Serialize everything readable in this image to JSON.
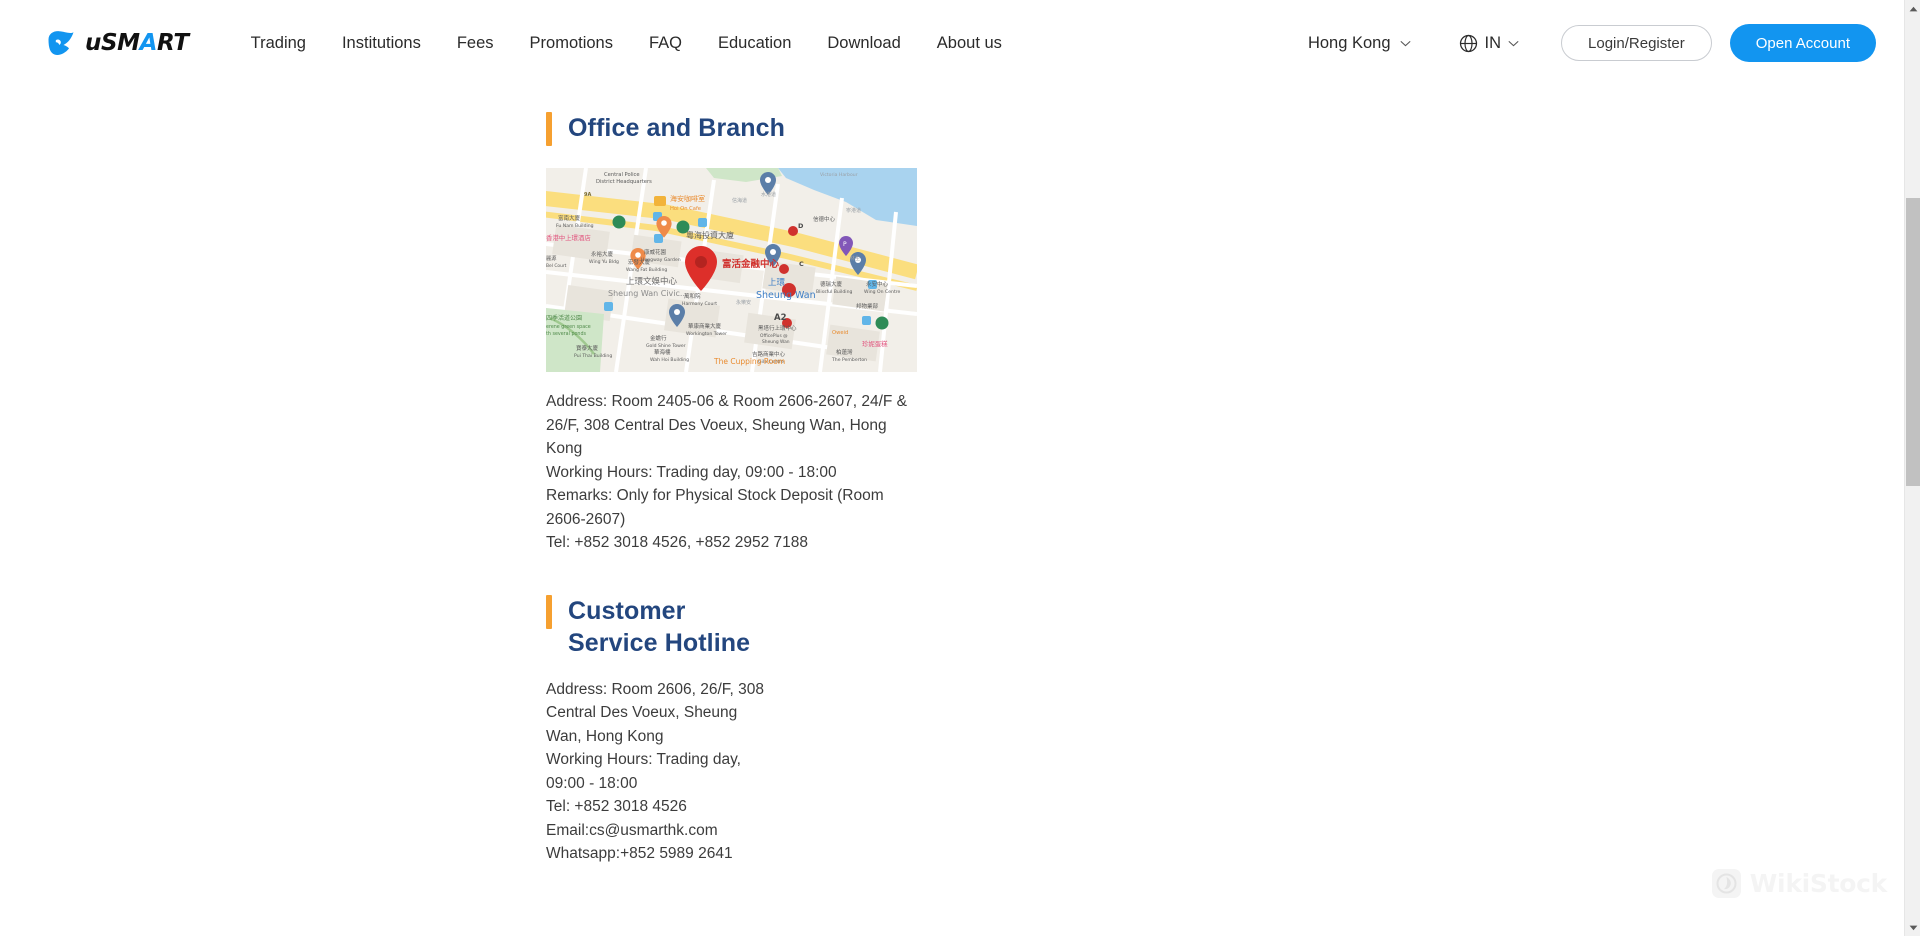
{
  "header": {
    "brand": {
      "logo_icon": "usmart-bird-logo-icon",
      "text_before_accent": "uSM",
      "accent_letter": "A",
      "text_after_accent": "RT",
      "accent_color": "#1295f0"
    },
    "nav": [
      {
        "label": "Trading"
      },
      {
        "label": "Institutions"
      },
      {
        "label": "Fees"
      },
      {
        "label": "Promotions"
      },
      {
        "label": "FAQ"
      },
      {
        "label": "Education"
      },
      {
        "label": "Download"
      },
      {
        "label": "About us"
      }
    ],
    "region": {
      "label": "Hong Kong",
      "chevron_icon": "chevron-down-icon"
    },
    "language": {
      "globe_icon": "globe-icon",
      "label": "IN",
      "chevron_icon": "chevron-down-icon"
    },
    "login_button": "Login/Register",
    "open_account_button": "Open Account",
    "open_account_color": "#1295f0"
  },
  "sections": [
    {
      "id": "office-and-branch",
      "title": "Office and Branch",
      "accent_bar_color": "#f6a030",
      "title_color": "#23467e",
      "map": {
        "name": "office-location-map",
        "pin_label": "富活金融中心",
        "station_label": "Sheung Wan",
        "station_label_cn": "上環",
        "landmarks": [
          "District Headquarters",
          "Hoi On Cafe",
          "海安咖啡室",
          "Fu Nam Building",
          "富南大廈",
          "香港中上環酒店",
          "粵海投資大廈",
          "Hongway Garden",
          "康威花園",
          "Ming Yu Building",
          "永裕大廈",
          "Wang Fat Building",
          "宏發大廈",
          "Sheung Wan Civic...",
          "上環文娛中心",
          "Harmony Court",
          "萬和院",
          "Gold Shine Tower",
          "金燿行",
          "Wah Hoi Building",
          "華海樓",
          "Workington Tower",
          "華康商業大廈",
          "OfficePlus @ Sheung Wan",
          "黑塔行上環中心",
          "Gilb Centre",
          "吉路商業中心",
          "The Pemberton",
          "柏莉灣",
          "The Cupping Room",
          "Blissful Building",
          "德瑞大廈",
          "Wing On Centre",
          "永安中心",
          "Serene green space with several ponds",
          "四季活道公園",
          "Pui Thai Building",
          "寶泰大廈",
          "信德中心",
          "寜港道",
          "A2",
          "C",
          "D"
        ]
      },
      "details": [
        "Address: Room 2405-06 & Room 2606-2607, 24/F & 26/F, 308 Central Des Voeux, Sheung Wan, Hong Kong",
        "Working Hours: Trading day, 09:00 - 18:00",
        "Remarks: Only for Physical Stock Deposit (Room 2606-2607)",
        "Tel: +852 3018 4526, +852 2952 7188"
      ]
    },
    {
      "id": "customer-service-hotline",
      "title": "Customer Service Hotline",
      "accent_bar_color": "#f6a030",
      "title_color": "#23467e",
      "details": [
        "Address: Room 2606, 26/F, 308 Central Des Voeux, Sheung Wan, Hong Kong",
        "Working Hours: Trading day, 09:00 - 18:00",
        "Tel: +852 3018 4526",
        "Email:cs@usmarthk.com",
        "Whatsapp:+852 5989 2641"
      ]
    }
  ],
  "watermark": {
    "text": "WikiStock",
    "icon": "wikistock-logo-icon"
  },
  "scrollbar": {
    "up_arrow_icon": "scroll-up-arrow-icon",
    "down_arrow_icon": "scroll-down-arrow-icon"
  }
}
